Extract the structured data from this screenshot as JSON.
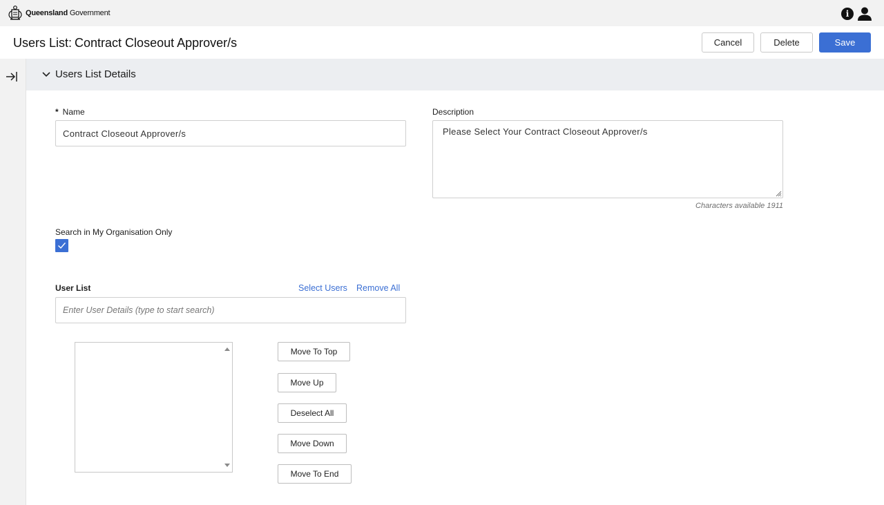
{
  "brand": {
    "name_bold": "Queensland",
    "name_rest": "Government",
    "crest_icon": "qld-crest-icon"
  },
  "topbar": {
    "info_icon": "info-icon",
    "info_glyph": "i",
    "user_icon": "user-icon"
  },
  "header": {
    "title_prefix": "Users List:",
    "title_name": "Contract Closeout Approver/s",
    "cancel_label": "Cancel",
    "delete_label": "Delete",
    "save_label": "Save"
  },
  "section": {
    "title": "Users List Details"
  },
  "form": {
    "name_required": "*",
    "name_label": "Name",
    "name_value": "Contract Closeout Approver/s",
    "description_label": "Description",
    "description_value": "Please Select Your Contract Closeout Approver/s",
    "characters_available": "Characters available 1911",
    "search_org_label": "Search in My Organisation Only",
    "search_org_checked": true,
    "user_list_label": "User List",
    "select_users_link": "Select Users",
    "remove_all_link": "Remove All",
    "user_search_placeholder": "Enter User Details (type to start search)"
  },
  "list_actions": {
    "move_top": "Move To Top",
    "move_up": "Move Up",
    "deselect_all": "Deselect All",
    "move_down": "Move Down",
    "move_end": "Move To End"
  },
  "colors": {
    "accent": "#3b6fd4",
    "rail": "#f2f2f2",
    "section": "#eceef1"
  }
}
